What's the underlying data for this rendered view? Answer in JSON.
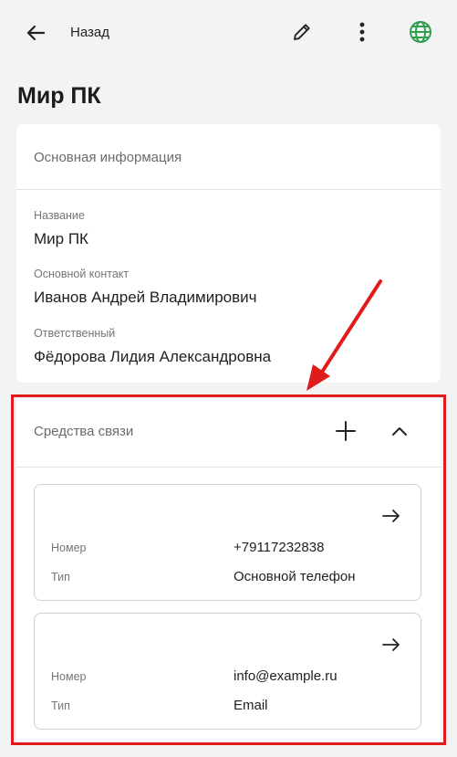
{
  "header": {
    "back_label": "Назад",
    "icons": [
      "back-arrow-icon",
      "pencil-icon",
      "more-vertical-icon",
      "globe-icon"
    ],
    "accent_color": "#2e9e4f"
  },
  "page": {
    "title": "Мир ПК"
  },
  "main_info": {
    "section_title": "Основная информация",
    "fields": [
      {
        "label": "Название",
        "value": "Мир ПК"
      },
      {
        "label": "Основной контакт",
        "value": "Иванов Андрей Владимирович"
      },
      {
        "label": "Ответственный",
        "value": "Фёдорова Лидия Александровна"
      }
    ]
  },
  "contacts": {
    "section_title": "Средства связи",
    "items": [
      {
        "number_label": "Номер",
        "number_value": "+79117232838",
        "type_label": "Тип",
        "type_value": "Основной телефон"
      },
      {
        "number_label": "Номер",
        "number_value": "info@example.ru",
        "type_label": "Тип",
        "type_value": "Email"
      }
    ]
  },
  "annotation": {
    "color": "#e01b1b"
  }
}
